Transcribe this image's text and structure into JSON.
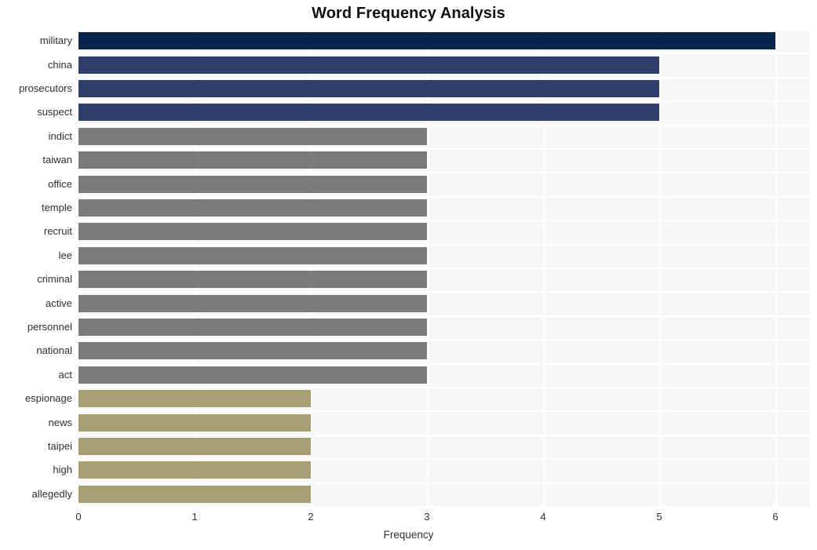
{
  "chart_data": {
    "type": "bar",
    "orientation": "horizontal",
    "title": "Word Frequency Analysis",
    "xlabel": "Frequency",
    "ylabel": "",
    "categories": [
      "military",
      "china",
      "prosecutors",
      "suspect",
      "indict",
      "taiwan",
      "office",
      "temple",
      "recruit",
      "lee",
      "criminal",
      "active",
      "personnel",
      "national",
      "act",
      "espionage",
      "news",
      "taipei",
      "high",
      "allegedly"
    ],
    "values": [
      6,
      5,
      5,
      5,
      3,
      3,
      3,
      3,
      3,
      3,
      3,
      3,
      3,
      3,
      3,
      2,
      2,
      2,
      2,
      2
    ],
    "bar_colors": [
      "#08244a",
      "#2e3f6d",
      "#2e3f6d",
      "#2e3f6d",
      "#7b7b7b",
      "#7b7b7b",
      "#7b7b7b",
      "#7b7b7b",
      "#7b7b7b",
      "#7b7b7b",
      "#7b7b7b",
      "#7b7b7b",
      "#7b7b7b",
      "#7b7b7b",
      "#7b7b7b",
      "#a89e74",
      "#a89e74",
      "#a89e74",
      "#a89e74",
      "#a89e74"
    ],
    "xlim": [
      0,
      6
    ],
    "xticks": [
      0,
      1,
      2,
      3,
      4,
      5,
      6
    ],
    "xtick_labels": [
      "0",
      "1",
      "2",
      "3",
      "4",
      "5",
      "6"
    ],
    "grid": true,
    "grid_color": "#ffffff",
    "plot_background": "#f7f7f7",
    "figure_background": "#ffffff",
    "legend": null
  },
  "colors": {
    "rank_1": "#08244a",
    "rank_2": "#2e3f6d",
    "rank_3": "#7b7b7b",
    "rank_4": "#a89e74",
    "text": "#2f2f2f",
    "title": "#111111"
  }
}
